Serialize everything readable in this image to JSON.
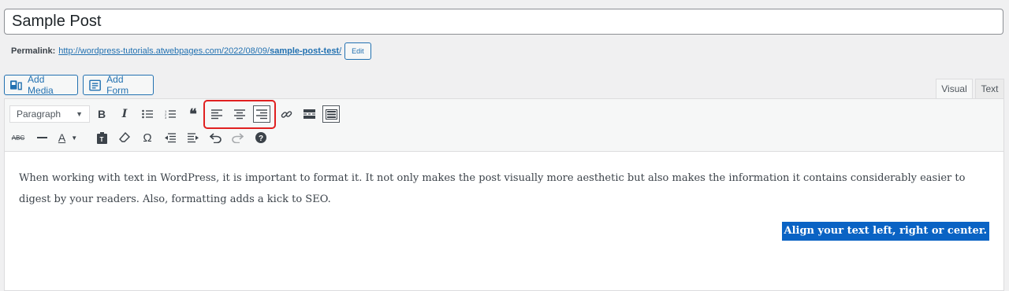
{
  "post": {
    "title": "Sample Post",
    "permalink_label": "Permalink:",
    "permalink_base": "http://wordpress-tutorials.atwebpages.com/2022/08/09/",
    "permalink_slug": "sample-post-test",
    "permalink_trailing": "/",
    "edit_label": "Edit"
  },
  "media_buttons": {
    "add_media": "Add Media",
    "add_form": "Add Form"
  },
  "tabs": {
    "visual": "Visual",
    "text": "Text"
  },
  "toolbar": {
    "format_select": "Paragraph",
    "row1_icons": [
      "bold-icon",
      "italic-icon",
      "bullet-list-icon",
      "numbered-list-icon",
      "blockquote-icon",
      "align-left-icon",
      "align-center-icon",
      "align-right-icon",
      "link-icon",
      "read-more-icon",
      "toolbar-toggle-icon"
    ],
    "row2_icons": [
      "strikethrough-icon",
      "horizontal-line-icon",
      "text-color-icon",
      "paste-text-icon",
      "clear-formatting-icon",
      "special-character-icon",
      "outdent-icon",
      "indent-icon",
      "undo-icon",
      "redo-icon",
      "help-icon"
    ],
    "highlight_color": "#e02020"
  },
  "content": {
    "paragraph": "When working with text in WordPress, it is important to format it. It not only makes the post visually more aesthetic but also makes the information it contains considerably easier to digest by your readers. Also, formatting adds a kick to SEO.",
    "selected_line": "Align your text left, right or center.",
    "selection_color": "#0a63c4"
  }
}
